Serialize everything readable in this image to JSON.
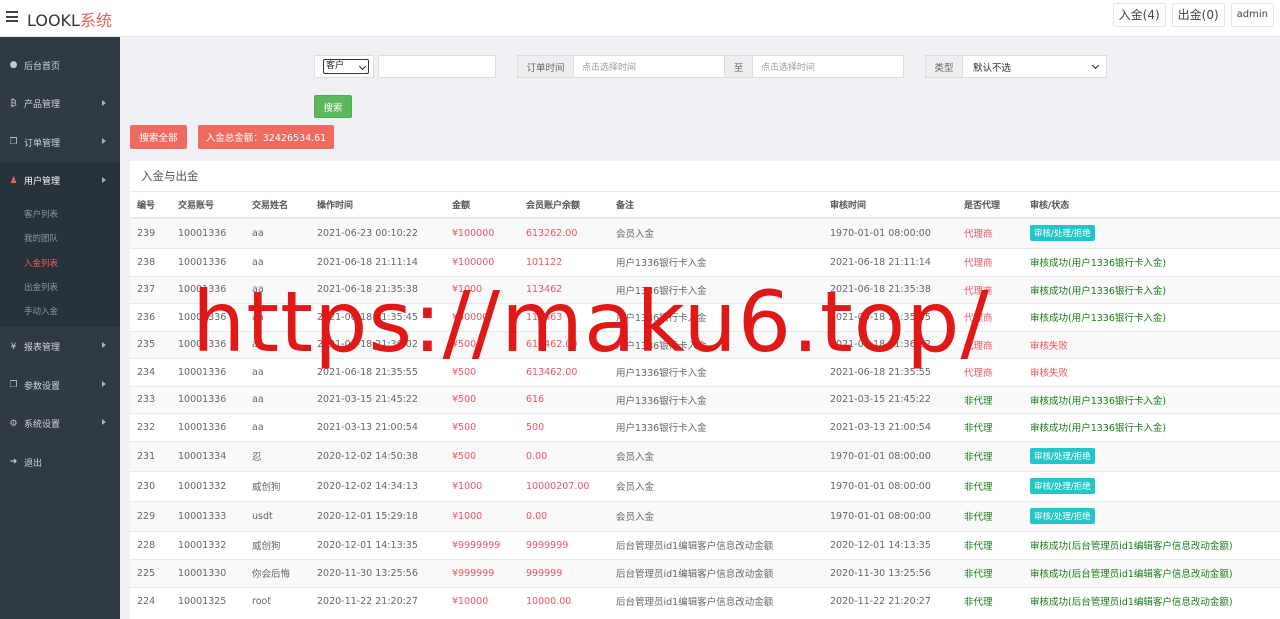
{
  "app": {
    "logo_text": "LOOKL",
    "logo_accent": "系统",
    "deposit_btn": "入金(4)",
    "withdraw_btn": "出金(0)",
    "user": "admin"
  },
  "sidebar": {
    "items": [
      {
        "label": "后台首页",
        "icon": "dashboard-icon"
      },
      {
        "label": "产品管理",
        "icon": "bitcoin-icon"
      },
      {
        "label": "订单管理",
        "icon": "copy-icon"
      },
      {
        "label": "用户管理",
        "icon": "user-icon"
      },
      {
        "label": "报表管理",
        "icon": "yen-icon"
      },
      {
        "label": "参数设置",
        "icon": "copy-icon"
      },
      {
        "label": "系统设置",
        "icon": "gears-icon"
      },
      {
        "label": "退出",
        "icon": "signout-icon"
      }
    ],
    "sub_items": [
      "客户列表",
      "我的团队",
      "入金列表",
      "出金列表",
      "手动入金"
    ]
  },
  "filters": {
    "field_select": "客户",
    "order_time_label": "订单时间",
    "start_placeholder": "点击选择时间",
    "to_label": "至",
    "end_placeholder": "点击选择时间",
    "type_label": "类型",
    "type_value": "默认不选",
    "search_btn": "搜索"
  },
  "actions": {
    "search_all": "搜索全部",
    "total_label": "入金总金额：32426534.61"
  },
  "panel": {
    "title": "入金与出金",
    "headers": [
      "编号",
      "交易账号",
      "交易姓名",
      "操作时间",
      "金额",
      "会员账户余额",
      "备注",
      "审核时间",
      "是否代理",
      "审核/状态"
    ],
    "rows": [
      {
        "id": "239",
        "account": "10001336",
        "name": "aa",
        "time": "2021-06-23 00:10:22",
        "amount": "¥100000",
        "balance": "613262.00",
        "note": "会员入金",
        "audit_time": "1970-01-01 08:00:00",
        "agent": "代理商",
        "status": "审核/处理/拒绝",
        "status_type": "badge"
      },
      {
        "id": "238",
        "account": "10001336",
        "name": "aa",
        "time": "2021-06-18 21:11:14",
        "amount": "¥100000",
        "balance": "101122",
        "note": "用户1336银行卡入金",
        "audit_time": "2021-06-18 21:11:14",
        "agent": "代理商",
        "status": "审核成功(用户1336银行卡入金)",
        "status_type": "text"
      },
      {
        "id": "237",
        "account": "10001336",
        "name": "aa",
        "time": "2021-06-18 21:35:38",
        "amount": "¥1000",
        "balance": "113462",
        "note": "用户1336银行卡入金",
        "audit_time": "2021-06-18 21:35:38",
        "agent": "代理商",
        "status": "审核成功(用户1336银行卡入金)",
        "status_type": "text"
      },
      {
        "id": "236",
        "account": "10001336",
        "name": "aa",
        "time": "2021-06-18 21:35:45",
        "amount": "¥50000",
        "balance": "113463",
        "note": "用户1336银行卡入金",
        "audit_time": "2021-06-18 21:35:45",
        "agent": "代理商",
        "status": "审核成功(用户1336银行卡入金)",
        "status_type": "text"
      },
      {
        "id": "235",
        "account": "10001336",
        "name": "aa",
        "time": "2021-06-18 21:36:02",
        "amount": "¥500",
        "balance": "613462.00",
        "note": "用户1336银行卡入金",
        "audit_time": "2021-06-18 21:36:02",
        "agent": "代理商",
        "status": "审核失败",
        "status_type": "fail"
      },
      {
        "id": "234",
        "account": "10001336",
        "name": "aa",
        "time": "2021-06-18 21:35:55",
        "amount": "¥500",
        "balance": "613462.00",
        "note": "用户1336银行卡入金",
        "audit_time": "2021-06-18 21:35:55",
        "agent": "代理商",
        "status": "审核失败",
        "status_type": "fail"
      },
      {
        "id": "233",
        "account": "10001336",
        "name": "aa",
        "time": "2021-03-15 21:45:22",
        "amount": "¥500",
        "balance": "616",
        "note": "用户1336银行卡入金",
        "audit_time": "2021-03-15 21:45:22",
        "agent": "非代理",
        "status": "审核成功(用户1336银行卡入金)",
        "status_type": "text"
      },
      {
        "id": "232",
        "account": "10001336",
        "name": "aa",
        "time": "2021-03-13 21:00:54",
        "amount": "¥500",
        "balance": "500",
        "note": "用户1336银行卡入金",
        "audit_time": "2021-03-13 21:00:54",
        "agent": "非代理",
        "status": "审核成功(用户1336银行卡入金)",
        "status_type": "text"
      },
      {
        "id": "231",
        "account": "10001334",
        "name": "忍",
        "time": "2020-12-02 14:50:38",
        "amount": "¥500",
        "balance": "0.00",
        "note": "会员入金",
        "audit_time": "1970-01-01 08:00:00",
        "agent": "非代理",
        "status": "审核/处理/拒绝",
        "status_type": "badge"
      },
      {
        "id": "230",
        "account": "10001332",
        "name": "威创狗",
        "time": "2020-12-02 14:34:13",
        "amount": "¥1000",
        "balance": "10000207.00",
        "note": "会员入金",
        "audit_time": "1970-01-01 08:00:00",
        "agent": "非代理",
        "status": "审核/处理/拒绝",
        "status_type": "badge"
      },
      {
        "id": "229",
        "account": "10001333",
        "name": "usdt",
        "time": "2020-12-01 15:29:18",
        "amount": "¥1000",
        "balance": "0.00",
        "note": "会员入金",
        "audit_time": "1970-01-01 08:00:00",
        "agent": "非代理",
        "status": "审核/处理/拒绝",
        "status_type": "badge"
      },
      {
        "id": "228",
        "account": "10001332",
        "name": "威创狗",
        "time": "2020-12-01 14:13:35",
        "amount": "¥9999999",
        "balance": "9999999",
        "note": "后台管理员id1编辑客户信息改动金额",
        "audit_time": "2020-12-01 14:13:35",
        "agent": "非代理",
        "status": "审核成功(后台管理员id1编辑客户信息改动金额)",
        "status_type": "text"
      },
      {
        "id": "225",
        "account": "10001330",
        "name": "你会后悔",
        "time": "2020-11-30 13:25:56",
        "amount": "¥999999",
        "balance": "999999",
        "note": "后台管理员id1编辑客户信息改动金额",
        "audit_time": "2020-11-30 13:25:56",
        "agent": "非代理",
        "status": "审核成功(后台管理员id1编辑客户信息改动金额)",
        "status_type": "text"
      },
      {
        "id": "224",
        "account": "10001325",
        "name": "root",
        "time": "2020-11-22 21:20:27",
        "amount": "¥10000",
        "balance": "10000.00",
        "note": "后台管理员id1编辑客户信息改动金额",
        "audit_time": "2020-11-22 21:20:27",
        "agent": "非代理",
        "status": "审核成功(后台管理员id1编辑客户信息改动金额)",
        "status_type": "text"
      }
    ]
  },
  "watermark": "https://maku6.top/",
  "colors": {
    "accent": "#e8615a",
    "sidebar": "#2f3a44",
    "green": "#5cb85c",
    "badge": "#23c6c8",
    "red_text": "#ed5565"
  }
}
